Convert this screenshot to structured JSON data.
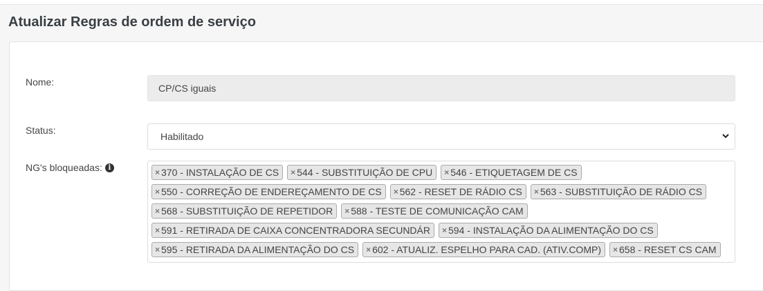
{
  "page": {
    "title": "Atualizar Regras de ordem de serviço"
  },
  "form": {
    "nome": {
      "label": "Nome:",
      "value": "CP/CS iguais"
    },
    "status": {
      "label": "Status:",
      "selected": "Habilitado"
    },
    "ng_bloqueadas": {
      "label": "NG's bloqueadas:",
      "remove_symbol": "×",
      "rows": [
        [
          "370 - INSTALAÇÃO DE CS",
          "544 - SUBSTITUIÇÃO DE CPU",
          "546 - ETIQUETAGEM DE CS"
        ],
        [
          "550 - CORREÇÃO DE ENDEREÇAMENTO DE CS",
          "562 - RESET DE RÁDIO CS",
          "563 - SUBSTITUIÇÃO DE RÁDIO CS"
        ],
        [
          "568 - SUBSTITUIÇÃO DE REPETIDOR",
          "588 - TESTE DE COMUNICAÇÃO CAM"
        ],
        [
          "591 - RETIRADA DE CAIXA CONCENTRADORA SECUNDÁR",
          "594 - INSTALAÇÃO DA ALIMENTAÇÃO DO CS"
        ],
        [
          "595 - RETIRADA DA ALIMENTAÇÃO DO CS",
          "602 - ATUALIZ. ESPELHO PARA CAD. (ATIV.COMP)",
          "658 - RESET CS CAM"
        ]
      ]
    }
  }
}
